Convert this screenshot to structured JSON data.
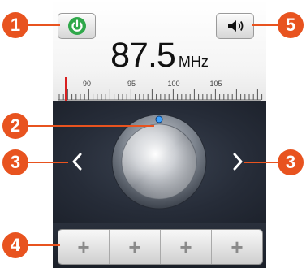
{
  "radio": {
    "frequency_value": "87.5",
    "frequency_unit": "MHz",
    "scale_labels": [
      "90",
      "95",
      "100",
      "105"
    ]
  },
  "presets": {
    "slot_label": "+",
    "slots": [
      "+",
      "+",
      "+",
      "+"
    ]
  },
  "callouts": {
    "power": "1",
    "tuner": "2",
    "prev": "3",
    "next": "3",
    "presets": "4",
    "speaker": "5"
  },
  "colors": {
    "callout": "#e8531f",
    "power_icon": "#2fa84a",
    "scale_needle": "#d81f1f",
    "knob_indicator": "#3aa0ff"
  },
  "icons": {
    "power": "power-icon",
    "speaker": "speaker-icon",
    "prev": "chevron-left-icon",
    "next": "chevron-right-icon"
  }
}
